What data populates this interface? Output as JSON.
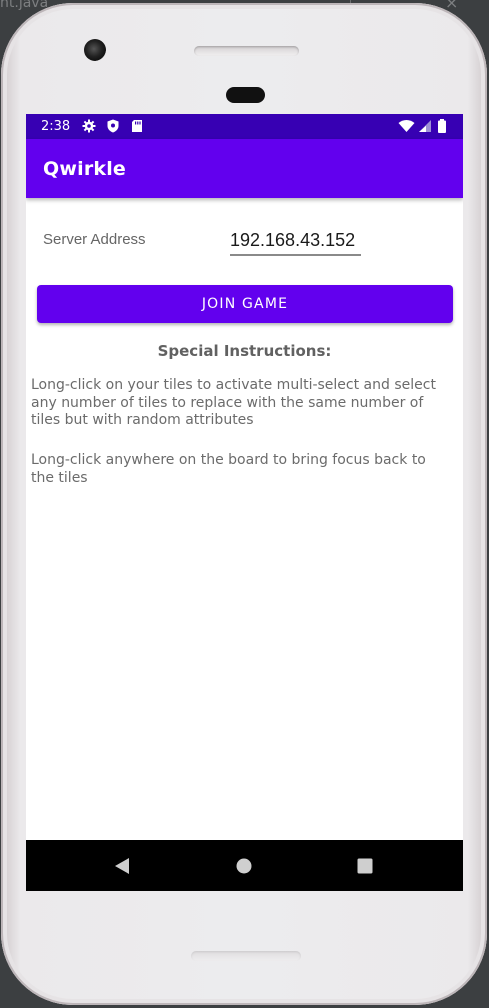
{
  "editor": {
    "tab_label": "nt.java",
    "close_glyph": "×"
  },
  "status_bar": {
    "time": "2:38",
    "left_icons": [
      "gear-icon",
      "shield-icon",
      "sd-card-icon"
    ],
    "right_icons": [
      "wifi-icon",
      "cell-signal-icon",
      "battery-icon"
    ],
    "color": "#3700b3"
  },
  "app_bar": {
    "title": "Qwirkle",
    "color": "#6200ee"
  },
  "form": {
    "server_label": "Server Address",
    "server_value": "192.168.43.152",
    "join_label": "JOIN GAME"
  },
  "instructions": {
    "title": "Special Instructions:",
    "paragraphs": [
      "Long-click on your tiles to activate multi-select and select any number of tiles to replace with the same number of tiles but with random attributes",
      "Long-click anywhere on the board to bring focus back to the tiles"
    ]
  },
  "nav_bar": {
    "buttons": [
      "back-icon",
      "home-icon",
      "recents-icon"
    ]
  }
}
